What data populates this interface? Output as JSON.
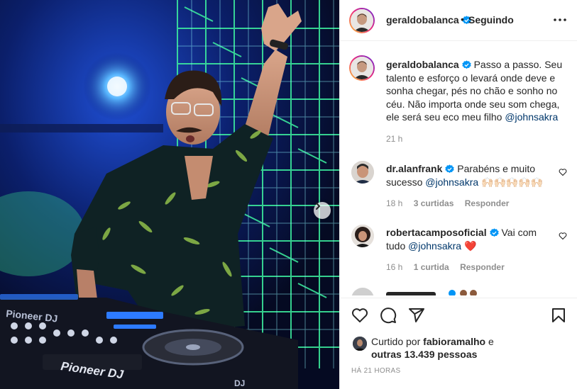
{
  "post": {
    "author": "geraldobalanca",
    "follow_status": "Seguindo",
    "header_separator": "•",
    "caption_text": "Passo a passo. Seu talento e esforço o levará onde deve e sonha chegar, pés no chão e sonho no céu. Não importa onde seu som chega, ele será seu eco meu filho",
    "caption_mention": "@johnsakra",
    "caption_time": "21 h",
    "photo_icons": {
      "next": "chevron-right-icon"
    }
  },
  "comments": [
    {
      "username": "dr.alanfrank",
      "text": "Parabéns e muito sucesso",
      "mention": "@johnsakra",
      "emoji": "🙌🏻🙌🏻🙌🏻🙌🏻🙌🏻",
      "time": "18 h",
      "likes": "3 curtidas",
      "reply": "Responder"
    },
    {
      "username": "robertacamposoficial",
      "text": "Vai com tudo",
      "mention": "@johnsakra",
      "emoji": "❤️",
      "time": "16 h",
      "likes": "1 curtida",
      "reply": "Responder"
    }
  ],
  "likes": {
    "prefix": "Curtido por",
    "user": "fabioramalho",
    "connector": "e",
    "others": "outras 13.439 pessoas"
  },
  "post_time": "HÁ 21 HORAS",
  "icons": {
    "verified": "verified-badge-icon",
    "more": "more-options-icon",
    "like": "heart-icon",
    "comment": "comment-icon",
    "share": "share-icon",
    "save": "bookmark-icon"
  },
  "colors": {
    "verified": "#0095f6",
    "link": "#00376b",
    "muted": "#8e8e8e",
    "heart_red": "#ed4956"
  }
}
